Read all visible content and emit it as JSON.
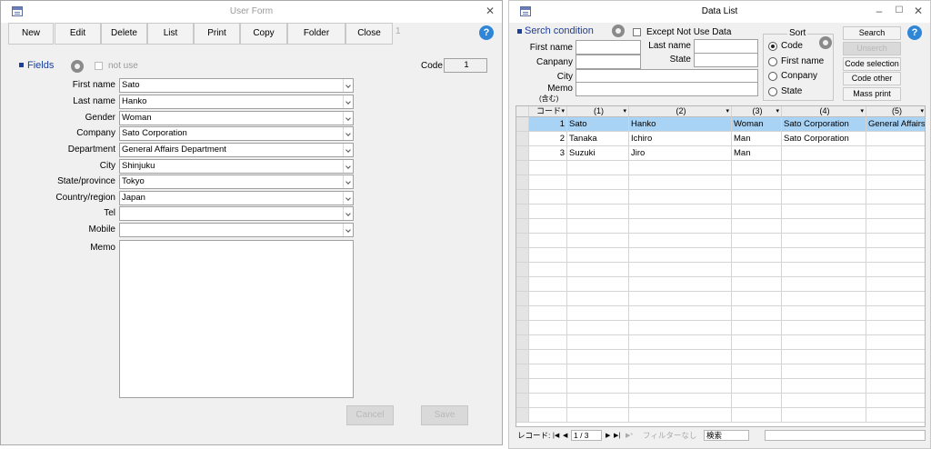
{
  "left": {
    "title": "User Form",
    "close_glyph": "✕",
    "toolbar": [
      "New",
      "Edit",
      "Delete",
      "List",
      "Print",
      "Copy",
      "Folder",
      "Close"
    ],
    "record_marker": "1",
    "help": "?",
    "fields_title": "Fields",
    "not_use_label": "not use",
    "code_label": "Code",
    "code_value": "1",
    "form": [
      {
        "label": "First name",
        "value": "Sato"
      },
      {
        "label": "Last name",
        "value": "Hanko"
      },
      {
        "label": "Gender",
        "value": "Woman"
      },
      {
        "label": "Company",
        "value": "Sato Corporation"
      },
      {
        "label": "Department",
        "value": "General Affairs Department"
      },
      {
        "label": "City",
        "value": "Shinjuku"
      },
      {
        "label": "State/province",
        "value": "Tokyo"
      },
      {
        "label": "Country/region",
        "value": "Japan"
      },
      {
        "label": "Tel",
        "value": ""
      },
      {
        "label": "Mobile",
        "value": ""
      }
    ],
    "memo_label": "Memo",
    "memo_value": "",
    "cancel_label": "Cancel",
    "save_label": "Save"
  },
  "right": {
    "title": "Data List",
    "min_glyph": "–",
    "max_glyph": "☐",
    "close_glyph": "✕",
    "search_title": "Serch condition",
    "except_label": "Except Not Use Data",
    "first_name_label": "First name",
    "company_label": "Canpany",
    "city_label": "City",
    "memo_label": "Memo",
    "memo_sub": "(含む)",
    "last_name_label": "Last name",
    "state_label": "State",
    "sort_title": "Sort",
    "sort_options": [
      "Code",
      "First name",
      "Conpany",
      "State"
    ],
    "buttons": [
      "Search",
      "Unserch",
      "Code selection",
      "Code other",
      "Mass print"
    ],
    "help": "?",
    "grid": {
      "headers": [
        "コード",
        "(1)",
        "(2)",
        "(3)",
        "(4)",
        "(5)"
      ],
      "rows": [
        [
          "1",
          "Sato",
          "Hanko",
          "Woman",
          "Sato Corporation",
          "General Affairs"
        ],
        [
          "2",
          "Tanaka",
          "Ichiro",
          "Man",
          "Sato Corporation",
          ""
        ],
        [
          "3",
          "Suzuki",
          "Jiro",
          "Man",
          "",
          ""
        ]
      ]
    },
    "status": {
      "record_label": "レコード:",
      "position": "1 / 3",
      "filter": "フィルターなし",
      "search": "検索"
    },
    "colors": {
      "highlight": "#a9d3f5",
      "accent": "#1b3f9a",
      "help": "#2f86d6"
    }
  }
}
